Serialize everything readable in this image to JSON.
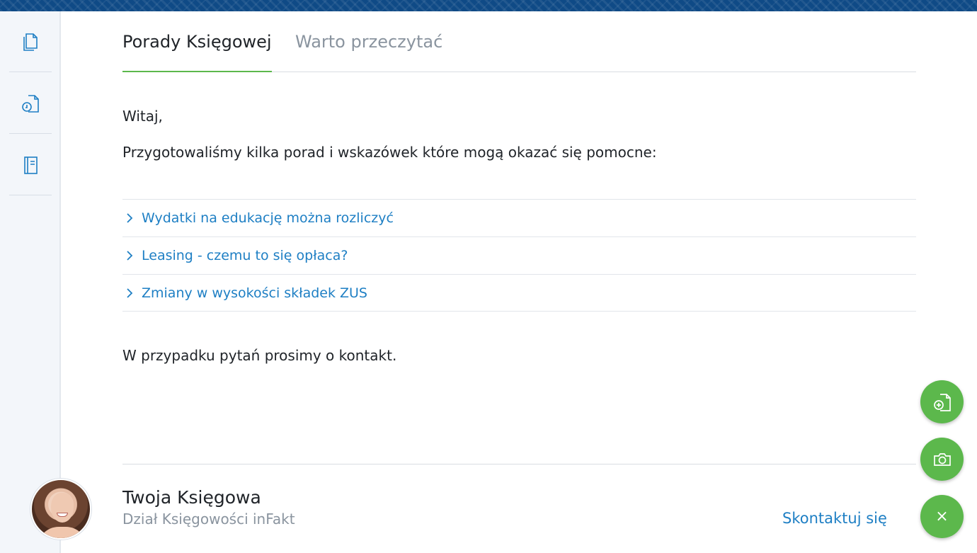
{
  "tabs": [
    {
      "label": "Porady Księgowej",
      "active": true
    },
    {
      "label": "Warto przeczytać",
      "active": false
    }
  ],
  "content": {
    "greeting": "Witaj,",
    "intro": "Przygotowaliśmy kilka porad i wskazówek które mogą okazać się pomocne:",
    "links": [
      {
        "label": "Wydatki na edukację można rozliczyć"
      },
      {
        "label": "Leasing - czemu to się opłaca?"
      },
      {
        "label": "Zmiany w wysokości składek ZUS"
      }
    ],
    "contact_note": "W przypadku pytań prosimy o kontakt."
  },
  "signature": {
    "name": "Twoja Księgowa",
    "department": "Dział Księgowości inFakt",
    "contact_label": "Skontaktuj się"
  },
  "sidebar": {
    "items": [
      {
        "icon": "documents-icon"
      },
      {
        "icon": "document-clock-icon"
      },
      {
        "icon": "notebook-icon"
      }
    ]
  },
  "fabs": [
    {
      "icon": "add-document-icon"
    },
    {
      "icon": "camera-icon"
    },
    {
      "icon": "close-icon",
      "glyph": "×"
    }
  ],
  "colors": {
    "accent_green": "#5cb84c",
    "link_blue": "#1e7fc4",
    "header_band": "#0f4a86"
  }
}
